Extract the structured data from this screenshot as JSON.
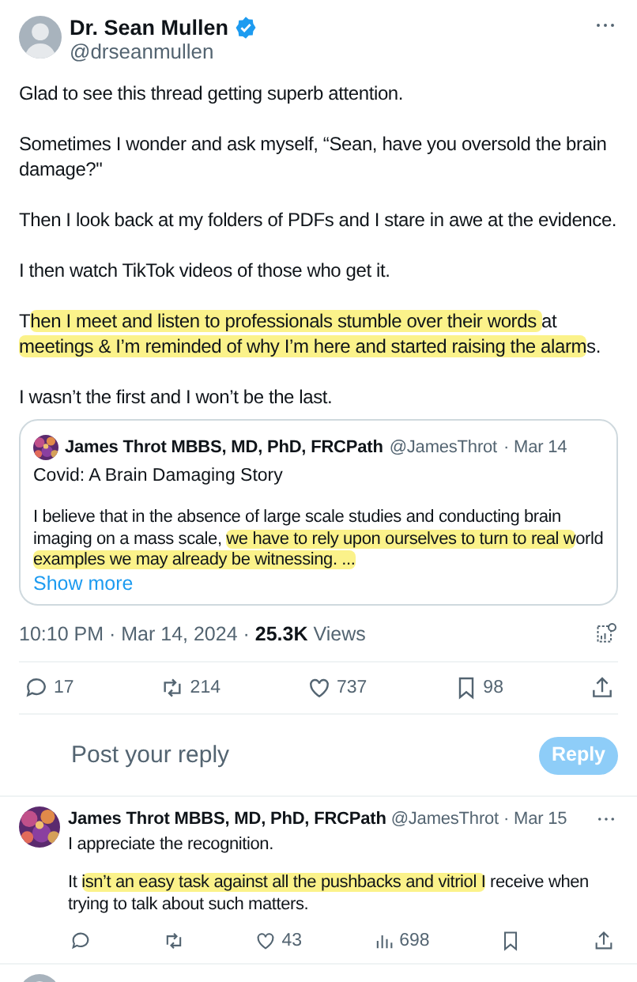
{
  "tweet": {
    "author": {
      "name": "Dr. Sean Mullen",
      "handle": "@drseanmullen",
      "verified": true
    },
    "paragraphs": [
      [
        {
          "text": "Glad to see this thread getting superb attention.",
          "highlighted": false
        }
      ],
      [
        {
          "text": "Sometimes I wonder and ask myself, “Sean, have you oversold the brain damage?\"",
          "highlighted": false
        }
      ],
      [
        {
          "text": "Then I look back at my folders of PDFs and I stare in awe at the evidence.",
          "highlighted": false
        }
      ],
      [
        {
          "text": "I then watch TikTok videos of those who get it.",
          "highlighted": false
        }
      ],
      [
        {
          "text": "T",
          "highlighted": false
        },
        {
          "text": "hen I meet and listen to professionals stumble over their words ",
          "highlighted": true
        },
        {
          "text": "at ",
          "highlighted": false
        },
        {
          "text": "meetings & I’m reminded of why I’m here and started raising the alarm",
          "highlighted": true
        },
        {
          "text": "s.",
          "highlighted": false
        }
      ],
      [
        {
          "text": "I wasn’t the first and I won’t be the last.",
          "highlighted": false
        }
      ]
    ],
    "quote": {
      "author": {
        "name": "James Throt MBBS, MD, PhD, FRCPath",
        "handle": "@JamesThrot",
        "date": "· Mar 14"
      },
      "title": "Covid: A Brain Damaging Story",
      "body": [
        {
          "text": "I believe that in the absence of large scale studies and conducting brain imaging on a mass scale, ",
          "highlighted": false
        },
        {
          "text": "we have to rely upon ourselves to turn to real w",
          "highlighted": true
        },
        {
          "text": "orld ",
          "highlighted": false
        },
        {
          "text": "examples we may already be witnessing. ...",
          "highlighted": true
        }
      ],
      "show_more": "Show more"
    },
    "meta": "10:10 PM · Mar 14, 2024 · **25.3K** Views",
    "actions": [
      {
        "kind": "reply",
        "count": "17"
      },
      {
        "kind": "repost",
        "count": "214"
      },
      {
        "kind": "like",
        "count": "737"
      },
      {
        "kind": "bookmark",
        "count": "98"
      },
      {
        "kind": "share"
      }
    ]
  },
  "composer": {
    "placeholder": "Post your reply",
    "button": "Reply",
    "disabled": true
  },
  "replies": [
    {
      "author": {
        "name": "James Throt MBBS, MD, PhD, FRCPath",
        "handle": "@JamesThrot",
        "date": "· Mar 15"
      },
      "paragraphs": [
        [
          {
            "text": "I appreciate the recognition.",
            "highlighted": false
          }
        ],
        [
          {
            "text": "It ",
            "highlighted": false
          },
          {
            "text": "isn’t an easy task against all the pushbacks and vitriol I",
            "highlighted": true
          },
          {
            "text": " receive when trying to talk about such matters.",
            "highlighted": false
          }
        ]
      ],
      "actions": [
        {
          "kind": "reply"
        },
        {
          "kind": "repost"
        },
        {
          "kind": "like",
          "count": "43"
        },
        {
          "kind": "views",
          "count": "698"
        },
        {
          "kind": "bookmark"
        },
        {
          "kind": "share"
        }
      ]
    }
  ]
}
